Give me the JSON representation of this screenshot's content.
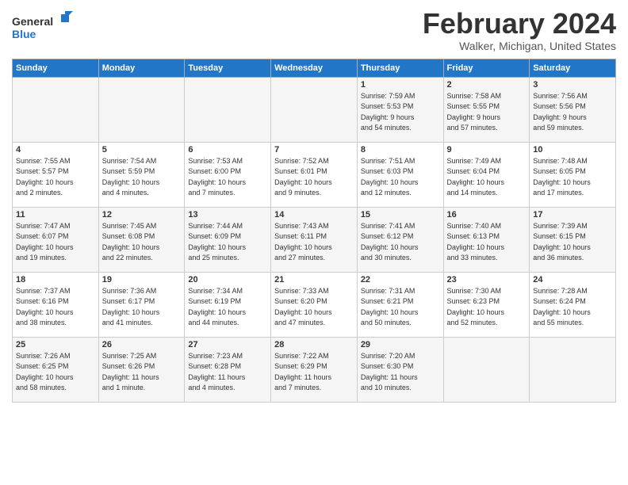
{
  "logo": {
    "general": "General",
    "blue": "Blue"
  },
  "header": {
    "month": "February 2024",
    "location": "Walker, Michigan, United States"
  },
  "days_of_week": [
    "Sunday",
    "Monday",
    "Tuesday",
    "Wednesday",
    "Thursday",
    "Friday",
    "Saturday"
  ],
  "weeks": [
    [
      {
        "day": "",
        "info": ""
      },
      {
        "day": "",
        "info": ""
      },
      {
        "day": "",
        "info": ""
      },
      {
        "day": "",
        "info": ""
      },
      {
        "day": "1",
        "info": "Sunrise: 7:59 AM\nSunset: 5:53 PM\nDaylight: 9 hours\nand 54 minutes."
      },
      {
        "day": "2",
        "info": "Sunrise: 7:58 AM\nSunset: 5:55 PM\nDaylight: 9 hours\nand 57 minutes."
      },
      {
        "day": "3",
        "info": "Sunrise: 7:56 AM\nSunset: 5:56 PM\nDaylight: 9 hours\nand 59 minutes."
      }
    ],
    [
      {
        "day": "4",
        "info": "Sunrise: 7:55 AM\nSunset: 5:57 PM\nDaylight: 10 hours\nand 2 minutes."
      },
      {
        "day": "5",
        "info": "Sunrise: 7:54 AM\nSunset: 5:59 PM\nDaylight: 10 hours\nand 4 minutes."
      },
      {
        "day": "6",
        "info": "Sunrise: 7:53 AM\nSunset: 6:00 PM\nDaylight: 10 hours\nand 7 minutes."
      },
      {
        "day": "7",
        "info": "Sunrise: 7:52 AM\nSunset: 6:01 PM\nDaylight: 10 hours\nand 9 minutes."
      },
      {
        "day": "8",
        "info": "Sunrise: 7:51 AM\nSunset: 6:03 PM\nDaylight: 10 hours\nand 12 minutes."
      },
      {
        "day": "9",
        "info": "Sunrise: 7:49 AM\nSunset: 6:04 PM\nDaylight: 10 hours\nand 14 minutes."
      },
      {
        "day": "10",
        "info": "Sunrise: 7:48 AM\nSunset: 6:05 PM\nDaylight: 10 hours\nand 17 minutes."
      }
    ],
    [
      {
        "day": "11",
        "info": "Sunrise: 7:47 AM\nSunset: 6:07 PM\nDaylight: 10 hours\nand 19 minutes."
      },
      {
        "day": "12",
        "info": "Sunrise: 7:45 AM\nSunset: 6:08 PM\nDaylight: 10 hours\nand 22 minutes."
      },
      {
        "day": "13",
        "info": "Sunrise: 7:44 AM\nSunset: 6:09 PM\nDaylight: 10 hours\nand 25 minutes."
      },
      {
        "day": "14",
        "info": "Sunrise: 7:43 AM\nSunset: 6:11 PM\nDaylight: 10 hours\nand 27 minutes."
      },
      {
        "day": "15",
        "info": "Sunrise: 7:41 AM\nSunset: 6:12 PM\nDaylight: 10 hours\nand 30 minutes."
      },
      {
        "day": "16",
        "info": "Sunrise: 7:40 AM\nSunset: 6:13 PM\nDaylight: 10 hours\nand 33 minutes."
      },
      {
        "day": "17",
        "info": "Sunrise: 7:39 AM\nSunset: 6:15 PM\nDaylight: 10 hours\nand 36 minutes."
      }
    ],
    [
      {
        "day": "18",
        "info": "Sunrise: 7:37 AM\nSunset: 6:16 PM\nDaylight: 10 hours\nand 38 minutes."
      },
      {
        "day": "19",
        "info": "Sunrise: 7:36 AM\nSunset: 6:17 PM\nDaylight: 10 hours\nand 41 minutes."
      },
      {
        "day": "20",
        "info": "Sunrise: 7:34 AM\nSunset: 6:19 PM\nDaylight: 10 hours\nand 44 minutes."
      },
      {
        "day": "21",
        "info": "Sunrise: 7:33 AM\nSunset: 6:20 PM\nDaylight: 10 hours\nand 47 minutes."
      },
      {
        "day": "22",
        "info": "Sunrise: 7:31 AM\nSunset: 6:21 PM\nDaylight: 10 hours\nand 50 minutes."
      },
      {
        "day": "23",
        "info": "Sunrise: 7:30 AM\nSunset: 6:23 PM\nDaylight: 10 hours\nand 52 minutes."
      },
      {
        "day": "24",
        "info": "Sunrise: 7:28 AM\nSunset: 6:24 PM\nDaylight: 10 hours\nand 55 minutes."
      }
    ],
    [
      {
        "day": "25",
        "info": "Sunrise: 7:26 AM\nSunset: 6:25 PM\nDaylight: 10 hours\nand 58 minutes."
      },
      {
        "day": "26",
        "info": "Sunrise: 7:25 AM\nSunset: 6:26 PM\nDaylight: 11 hours\nand 1 minute."
      },
      {
        "day": "27",
        "info": "Sunrise: 7:23 AM\nSunset: 6:28 PM\nDaylight: 11 hours\nand 4 minutes."
      },
      {
        "day": "28",
        "info": "Sunrise: 7:22 AM\nSunset: 6:29 PM\nDaylight: 11 hours\nand 7 minutes."
      },
      {
        "day": "29",
        "info": "Sunrise: 7:20 AM\nSunset: 6:30 PM\nDaylight: 11 hours\nand 10 minutes."
      },
      {
        "day": "",
        "info": ""
      },
      {
        "day": "",
        "info": ""
      }
    ]
  ]
}
